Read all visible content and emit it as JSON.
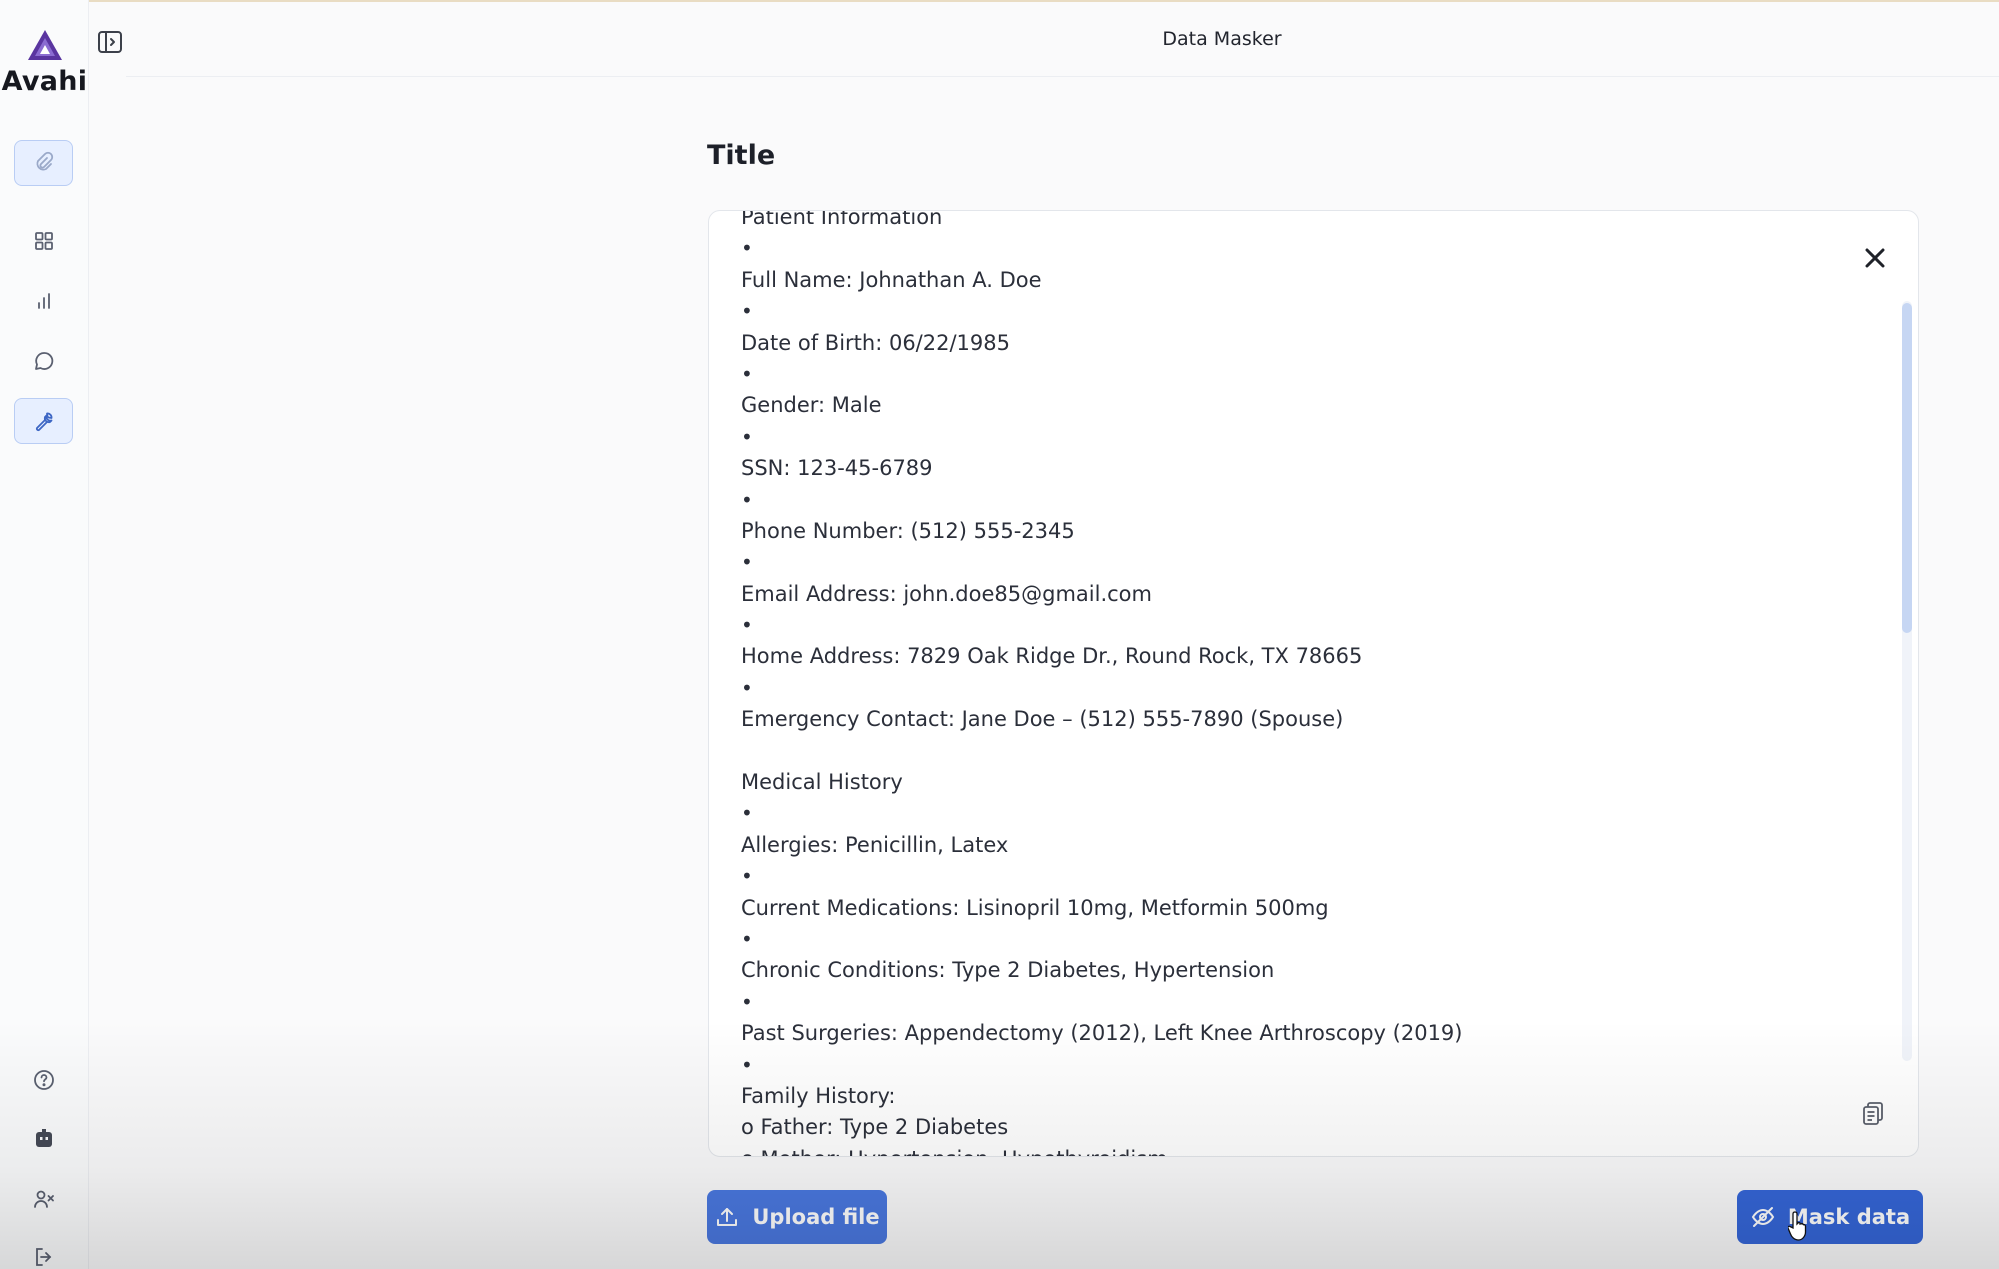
{
  "app": {
    "brand": "Avahi",
    "page_title": "Data Masker"
  },
  "sidebar": {
    "items": [
      {
        "name": "clip",
        "icon": "paperclip-icon",
        "active": true
      },
      {
        "name": "dashboard",
        "icon": "grid-icon",
        "active": false
      },
      {
        "name": "analytics",
        "icon": "bar-chart-icon",
        "active": false
      },
      {
        "name": "chat",
        "icon": "chat-bubble-icon",
        "active": false
      },
      {
        "name": "tools",
        "icon": "wrench-icon",
        "active": true
      }
    ],
    "bottom_items": [
      {
        "name": "help",
        "icon": "help-circle-icon"
      },
      {
        "name": "bot",
        "icon": "robot-icon"
      },
      {
        "name": "users",
        "icon": "user-x-icon"
      },
      {
        "name": "logout",
        "icon": "logout-icon"
      }
    ]
  },
  "main": {
    "section_title": "Title",
    "document_lines": [
      "Patient Information",
      "•",
      "Full Name: Johnathan A. Doe",
      "•",
      "Date of Birth: 06/22/1985",
      "•",
      "Gender: Male",
      "•",
      "SSN: 123-45-6789",
      "•",
      "Phone Number: (512) 555-2345",
      "•",
      "Email Address: john.doe85@gmail.com",
      "•",
      "Home Address: 7829 Oak Ridge Dr., Round Rock, TX 78665",
      "•",
      "Emergency Contact: Jane Doe – (512) 555-7890 (Spouse)",
      "",
      "Medical History",
      "•",
      "Allergies: Penicillin, Latex",
      "•",
      "Current Medications: Lisinopril 10mg, Metformin 500mg",
      "•",
      "Chronic Conditions: Type 2 Diabetes, Hypertension",
      "•",
      "Past Surgeries: Appendectomy (2012), Left Knee Arthroscopy (2019)",
      "•",
      "Family History:",
      "o Father: Type 2 Diabetes",
      "o Mother: Hypertension, Hypothyroidism"
    ],
    "upload_label": "Upload file",
    "mask_label": "Mask data"
  },
  "colors": {
    "accent": "#3566d8",
    "accent_light": "#e7efff",
    "brand": "#6b3fa8"
  }
}
